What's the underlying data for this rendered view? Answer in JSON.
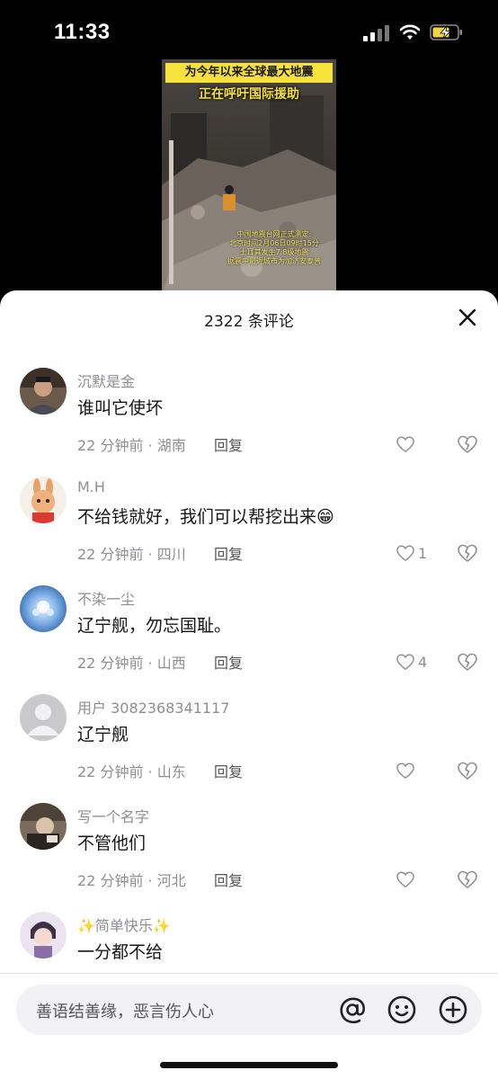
{
  "status_bar": {
    "time": "11:33"
  },
  "video": {
    "caption_line1": "为今年以来全球最大地震",
    "caption_line2": "正在呼吁国际援助",
    "info_lines": [
      "中国地震台网正式测定:",
      "北京时间2月06日09时15分",
      "土耳其发生7.8级地震",
      "据震中最近城市为加济安泰普"
    ]
  },
  "panel": {
    "comment_count": "2322 条评论",
    "close_icon": "close-icon"
  },
  "comments": [
    {
      "username": "沉默是金",
      "text": "谁叫它使坏",
      "meta": "22 分钟前 · 湖南",
      "reply": "回复",
      "likes": ""
    },
    {
      "username": "M.H",
      "text": "不给钱就好，我们可以帮挖出来😁",
      "meta": "22 分钟前 · 四川",
      "reply": "回复",
      "likes": "1"
    },
    {
      "username": "不染一尘",
      "text": "辽宁舰，勿忘国耻。",
      "meta": "22 分钟前 · 山西",
      "reply": "回复",
      "likes": "4"
    },
    {
      "username": "用户 3082368341117",
      "text": "辽宁舰",
      "meta": "22 分钟前 · 山东",
      "reply": "回复",
      "likes": ""
    },
    {
      "username": "写一个名字",
      "text": "不管他们",
      "meta": "22 分钟前 · 河北",
      "reply": "回复",
      "likes": ""
    },
    {
      "username": "✨简单快乐✨",
      "text": "一分都不给",
      "meta": "",
      "reply": "",
      "likes": ""
    }
  ],
  "input": {
    "placeholder": "善语结善缘，恶言伤人心",
    "icons": [
      "at-icon",
      "emoji-icon",
      "plus-icon"
    ]
  },
  "colors": {
    "accent_yellow": "#f6e23a",
    "text_gray": "#8e8e93",
    "battery_green": "#f5d33a"
  }
}
